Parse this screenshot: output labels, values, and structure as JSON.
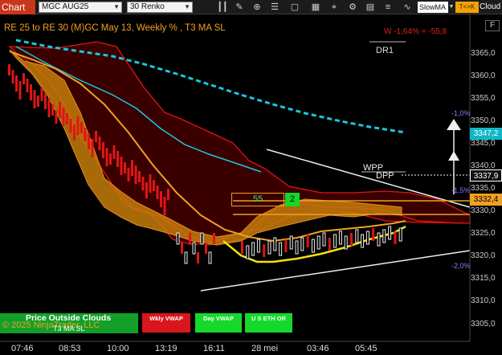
{
  "toolbar": {
    "chart_tab": "Chart",
    "instrument": "MGC AUG25",
    "bar_type": "30 Renko",
    "slow_ma": "SlowMA",
    "tk_button": "T<>K",
    "cloud_label": "Cloud",
    "icons": [
      "bars-icon",
      "pencil-icon",
      "magnifier-icon",
      "sliders-icon",
      "window-icon",
      "grid-icon",
      "crosshair-icon",
      "gear-icon",
      "chart-icon",
      "list-icon",
      "chart-line-icon"
    ]
  },
  "chart": {
    "header_text": "RE 25 to RE 30 (M)GC May 13, Weekly % , T3 MA SL",
    "weekly_change": "W -1,64% = -55,8",
    "dr1_label": "DR1",
    "wpp_label": "WPP",
    "dpp_label": "DPP",
    "pct_labels": [
      "-1,0%",
      "-1,5%",
      "-2,0%"
    ],
    "f_button": "F",
    "y_ticks": [
      "3365,0",
      "3360,0",
      "3355,0",
      "3350,0",
      "3345,0",
      "3340,0",
      "3335,0",
      "3330,0",
      "3325,0",
      "3320,0",
      "3315,0",
      "3310,0",
      "3305,0"
    ],
    "x_ticks": [
      "07:46",
      "08:53",
      "10:00",
      "13:19",
      "16:11",
      "28 mei",
      "03:46",
      "05:45"
    ],
    "price_tags": [
      {
        "text": "3347,2",
        "color": "#0fb7c5"
      },
      {
        "text": "3337,9",
        "color": "#ffffff"
      },
      {
        "text": "3332,4",
        "color": "#f1a022"
      }
    ],
    "box_value": "55",
    "box_small_value": "2"
  },
  "panel": {
    "copyright": "© 2025 NinjaTrader, LLC",
    "price_outside_clouds": "Price Outside Clouds",
    "t3_ma_sl": "T3 MA SL",
    "buttons": [
      {
        "label": "Wkly VWAP",
        "color": "#d8161b"
      },
      {
        "label": "Day VWAP",
        "color": "#15d92a"
      },
      {
        "label": "U S ETH OR",
        "color": "#15d92a"
      }
    ]
  }
}
